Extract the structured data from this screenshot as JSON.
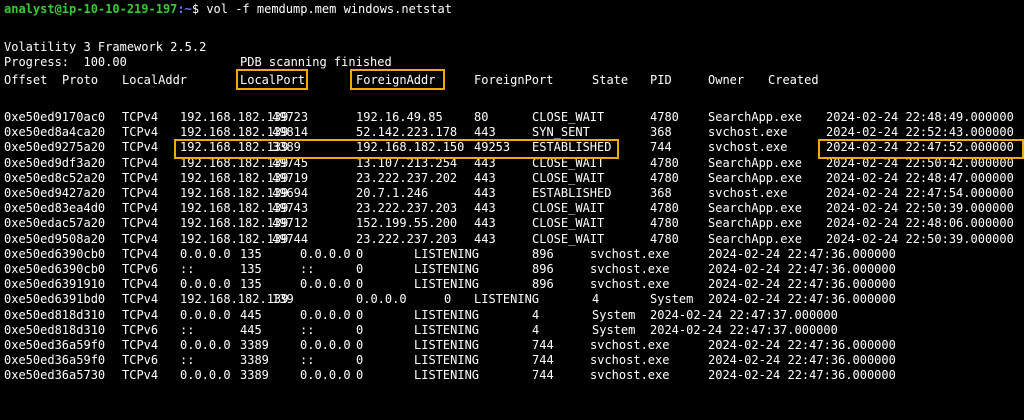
{
  "prompt": {
    "user_host": "analyst@ip-10-10-219-197",
    "path": ":~",
    "symbol": "$",
    "command": "vol -f memdump.mem windows.netstat"
  },
  "output": {
    "version": "Volatility 3 Framework 2.5.2",
    "progress_label": "Progress:",
    "progress_value": "100.00",
    "status": "PDB scanning finished"
  },
  "headers": [
    "Offset",
    "Proto",
    "LocalAddr",
    "LocalPort",
    "ForeignAddr",
    "ForeignPort",
    "State",
    "PID",
    "Owner",
    "Created"
  ],
  "rows": [
    [
      "0xe50ed9170ac0",
      "TCPv4",
      "192.168.182.139",
      "49723",
      "192.16.49.85",
      "80",
      "CLOSE_WAIT",
      "4780",
      "SearchApp.exe",
      "2024-02-24 22:48:49.000000"
    ],
    [
      "0xe50ed8a4ca20",
      "TCPv4",
      "192.168.182.139",
      "49814",
      "52.142.223.178",
      "443",
      "SYN_SENT",
      "368",
      "svchost.exe",
      "2024-02-24 22:52:43.000000"
    ],
    [
      "0xe50ed9275a20",
      "TCPv4",
      "192.168.182.139",
      "3389",
      "192.168.182.150",
      "49253",
      "ESTABLISHED",
      "744",
      "svchost.exe",
      "2024-02-24 22:47:52.000000"
    ],
    [
      "0xe50ed9df3a20",
      "TCPv4",
      "192.168.182.139",
      "49745",
      "13.107.213.254",
      "443",
      "CLOSE_WAIT",
      "4780",
      "SearchApp.exe",
      "2024-02-24 22:50:42.000000"
    ],
    [
      "0xe50ed8c52a20",
      "TCPv4",
      "192.168.182.139",
      "49719",
      "23.222.237.202",
      "443",
      "CLOSE_WAIT",
      "4780",
      "SearchApp.exe",
      "2024-02-24 22:48:47.000000"
    ],
    [
      "0xe50ed9427a20",
      "TCPv4",
      "192.168.182.139",
      "49694",
      "20.7.1.246",
      "443",
      "ESTABLISHED",
      "368",
      "svchost.exe",
      "2024-02-24 22:47:54.000000"
    ],
    [
      "0xe50ed83ea4d0",
      "TCPv4",
      "192.168.182.139",
      "49743",
      "23.222.237.203",
      "443",
      "CLOSE_WAIT",
      "4780",
      "SearchApp.exe",
      "2024-02-24 22:50:39.000000"
    ],
    [
      "0xe50edac57a20",
      "TCPv4",
      "192.168.182.139",
      "49712",
      "152.199.55.200",
      "443",
      "CLOSE_WAIT",
      "4780",
      "SearchApp.exe",
      "2024-02-24 22:48:06.000000"
    ],
    [
      "0xe50ed9508a20",
      "TCPv4",
      "192.168.182.139",
      "49744",
      "23.222.237.203",
      "443",
      "CLOSE_WAIT",
      "4780",
      "SearchApp.exe",
      "2024-02-24 22:50:39.000000"
    ],
    [
      "0xe50ed6390cb0",
      "TCPv4",
      "0.0.0.0",
      "135",
      "0.0.0.0",
      "0",
      "LISTENING",
      "896",
      "svchost.exe",
      "2024-02-24 22:47:36.000000"
    ],
    [
      "0xe50ed6390cb0",
      "TCPv6",
      "::",
      "135",
      "::",
      "0",
      "LISTENING",
      "896",
      "svchost.exe",
      "2024-02-24 22:47:36.000000"
    ],
    [
      "0xe50ed6391910",
      "TCPv4",
      "0.0.0.0",
      "135",
      "0.0.0.0",
      "0",
      "LISTENING",
      "896",
      "svchost.exe",
      "2024-02-24 22:47:36.000000"
    ],
    [
      "0xe50ed6391bd0",
      "TCPv4",
      "192.168.182.139",
      "139",
      "0.0.0.0",
      "0",
      "LISTENING",
      "4",
      "System",
      "2024-02-24 22:47:36.000000"
    ],
    [
      "0xe50ed818d310",
      "TCPv4",
      "0.0.0.0",
      "445",
      "0.0.0.0",
      "0",
      "LISTENING",
      "4",
      "System",
      "2024-02-24 22:47:37.000000"
    ],
    [
      "0xe50ed818d310",
      "TCPv6",
      "::",
      "445",
      "::",
      "0",
      "LISTENING",
      "4",
      "System",
      "2024-02-24 22:47:37.000000"
    ],
    [
      "0xe50ed36a59f0",
      "TCPv4",
      "0.0.0.0",
      "3389",
      "0.0.0.0",
      "0",
      "LISTENING",
      "744",
      "svchost.exe",
      "2024-02-24 22:47:36.000000"
    ],
    [
      "0xe50ed36a59f0",
      "TCPv6",
      "::",
      "3389",
      "::",
      "0",
      "LISTENING",
      "744",
      "svchost.exe",
      "2024-02-24 22:47:36.000000"
    ],
    [
      "0xe50ed36a5730",
      "TCPv4",
      "0.0.0.0",
      "3389",
      "0.0.0.0",
      "0",
      "LISTENING",
      "744",
      "svchost.exe",
      "2024-02-24 22:47:36.000000"
    ]
  ],
  "highlight_color": "#f2a900"
}
